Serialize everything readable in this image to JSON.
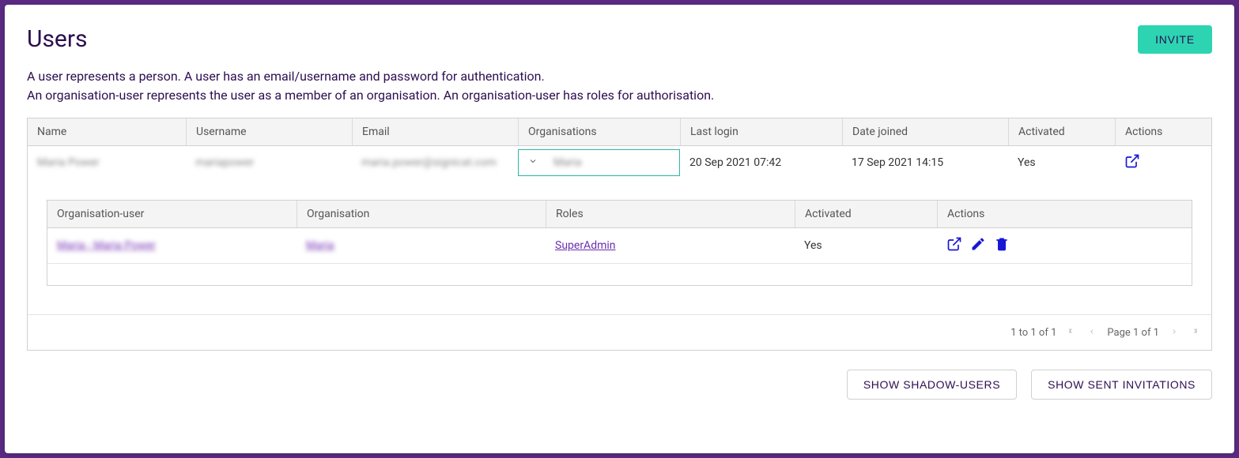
{
  "page": {
    "title": "Users",
    "desc_line1": "A user represents a person. A user has an email/username and password for authentication.",
    "desc_line2": "An organisation-user represents the user as a member of an organisation. An organisation-user has roles for authorisation."
  },
  "buttons": {
    "invite": "INVITE",
    "show_shadow": "SHOW SHADOW-USERS",
    "show_invites": "SHOW SENT INVITATIONS"
  },
  "table": {
    "headers": {
      "name": "Name",
      "username": "Username",
      "email": "Email",
      "organisations": "Organisations",
      "last_login": "Last login",
      "date_joined": "Date joined",
      "activated": "Activated",
      "actions": "Actions"
    },
    "row": {
      "name": "Maria Power",
      "username": "mariapower",
      "email": "maria.power@signicat.com",
      "org_value": "Maria",
      "last_login": "20 Sep 2021 07:42",
      "date_joined": "17 Sep 2021 14:15",
      "activated": "Yes"
    }
  },
  "inner_table": {
    "headers": {
      "org_user": "Organisation-user",
      "organisation": "Organisation",
      "roles": "Roles",
      "activated": "Activated",
      "actions": "Actions"
    },
    "row": {
      "org_user": "Maria - Maria Power",
      "organisation": "Maria",
      "role": "SuperAdmin",
      "activated": "Yes"
    }
  },
  "pager": {
    "range": "1 to 1 of 1",
    "page_label": "Page 1 of 1"
  }
}
